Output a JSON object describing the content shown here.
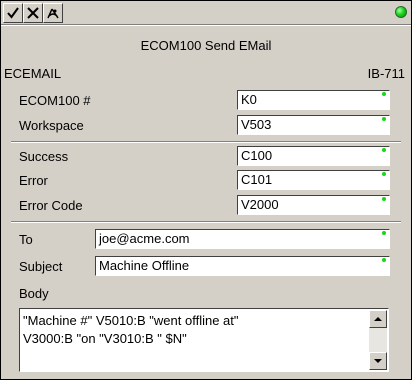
{
  "toolbar": {
    "buttons": [
      {
        "icon": "check-icon"
      },
      {
        "icon": "cancel-x-icon"
      },
      {
        "icon": "help-icon"
      }
    ],
    "status_color": "#19d619"
  },
  "title": "ECOM100 Send EMail",
  "instruction": {
    "name": "ECEMAIL",
    "id": "IB-711"
  },
  "fields": [
    {
      "label": "ECOM100 #",
      "value": "K0"
    },
    {
      "label": "Workspace",
      "value": "V503"
    },
    {
      "label": "Success",
      "value": "C100"
    },
    {
      "label": "Error",
      "value": "C101"
    },
    {
      "label": "Error Code",
      "value": "V2000"
    }
  ],
  "email": {
    "to_label": "To",
    "to_value": "joe@acme.com",
    "subject_label": "Subject",
    "subject_value": "Machine Offline",
    "body_label": "Body",
    "body_value": "\"Machine #\" V5010:B \"went offline at\"\nV3000:B \"on \"V3010:B \" $N\""
  }
}
